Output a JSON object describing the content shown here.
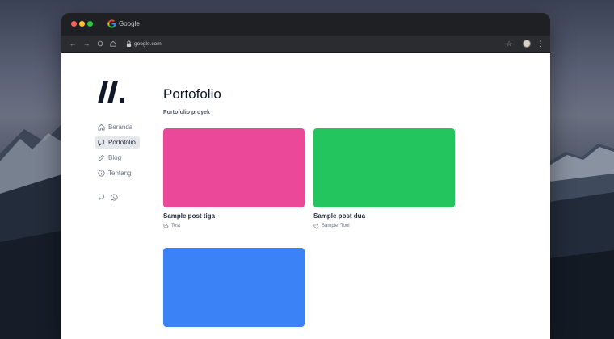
{
  "colors": {
    "card_pink": "#ec4899",
    "card_green": "#22c55e",
    "card_blue": "#3b82f6",
    "sidebar_active_bg": "#e5e7eb"
  },
  "browser": {
    "tab_title": "Google",
    "address": "google.com",
    "icons": [
      "back-arrow-icon",
      "forward-arrow-icon",
      "reload-icon",
      "home-icon",
      "lock-icon",
      "star-icon",
      "profile-avatar-icon",
      "kebab-menu-icon"
    ]
  },
  "sidebar": {
    "items": [
      {
        "label": "Beranda",
        "icon": "home-icon",
        "active": false
      },
      {
        "label": "Portofolio",
        "icon": "chat-icon",
        "active": true
      },
      {
        "label": "Blog",
        "icon": "edit-icon",
        "active": false
      },
      {
        "label": "Tentang",
        "icon": "info-icon",
        "active": false
      }
    ],
    "social_icons": [
      "github-icon",
      "whatsapp-icon"
    ]
  },
  "main": {
    "title": "Portofolio",
    "subtitle": "Portofolio proyek",
    "cards": [
      {
        "title": "Sample post tiga",
        "tags": "Test",
        "color": "#ec4899"
      },
      {
        "title": "Sample post dua",
        "tags": "Sample, Tool",
        "color": "#22c55e"
      },
      {
        "title": "",
        "tags": "",
        "color": "#3b82f6"
      }
    ]
  }
}
